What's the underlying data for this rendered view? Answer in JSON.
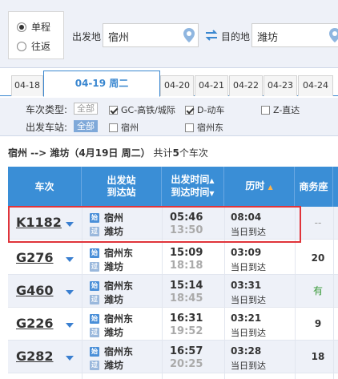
{
  "search": {
    "trip_types": [
      {
        "label": "单程",
        "selected": true
      },
      {
        "label": "往返",
        "selected": false
      }
    ],
    "from_label": "出发地",
    "from_value": "宿州",
    "to_label": "目的地",
    "to_value": "潍坊"
  },
  "date_tabs": [
    {
      "label": "04-18",
      "active": false
    },
    {
      "label": "04-19 周二",
      "active": true
    },
    {
      "label": "04-20",
      "active": false
    },
    {
      "label": "04-21",
      "active": false
    },
    {
      "label": "04-22",
      "active": false
    },
    {
      "label": "04-23",
      "active": false
    },
    {
      "label": "04-24",
      "active": false
    }
  ],
  "filters": {
    "type_label": "车次类型:",
    "type_all": "全部",
    "types": [
      {
        "label": "GC-高铁/城际",
        "checked": true
      },
      {
        "label": "D-动车",
        "checked": true
      },
      {
        "label": "Z-直达",
        "checked": false
      }
    ],
    "station_label": "出发车站:",
    "station_all": "全部",
    "stations": [
      {
        "label": "宿州",
        "checked": false
      },
      {
        "label": "宿州东",
        "checked": false
      }
    ]
  },
  "summary": {
    "route": "宿州 --> 潍坊（4月19日 周二）",
    "prefix": "共计",
    "count": "5",
    "suffix": "个车次"
  },
  "table": {
    "headers": {
      "train": "车次",
      "stations_top": "出发站",
      "stations_bottom": "到达站",
      "time_top": "出发时间",
      "time_bottom": "到达时间",
      "duration": "历时",
      "business": "商务座"
    },
    "rows": [
      {
        "train": "K1182",
        "from": "宿州",
        "to": "潍坊",
        "dep": "05:46",
        "arr": "13:50",
        "duration": "08:04",
        "arrival_day": "当日到达",
        "business": "--"
      },
      {
        "train": "G276",
        "from": "宿州东",
        "to": "潍坊",
        "dep": "15:09",
        "arr": "18:18",
        "duration": "03:09",
        "arrival_day": "当日到达",
        "business": "20"
      },
      {
        "train": "G460",
        "from": "宿州东",
        "to": "潍坊",
        "dep": "15:14",
        "arr": "18:45",
        "duration": "03:31",
        "arrival_day": "当日到达",
        "business": "有"
      },
      {
        "train": "G226",
        "from": "宿州东",
        "to": "潍坊",
        "dep": "16:31",
        "arr": "19:52",
        "duration": "03:21",
        "arrival_day": "当日到达",
        "business": "9"
      },
      {
        "train": "G282",
        "from": "宿州东",
        "to": "潍坊",
        "dep": "16:57",
        "arr": "20:25",
        "duration": "03:28",
        "arrival_day": "当日到达",
        "business": "18"
      }
    ],
    "station_icons": [
      "始",
      "过"
    ]
  },
  "colors": {
    "header_blue": "#3a8ed6",
    "accent_blue": "#3a87d0",
    "highlight_red": "#e0343a",
    "available_green": "#3a9a3a"
  }
}
